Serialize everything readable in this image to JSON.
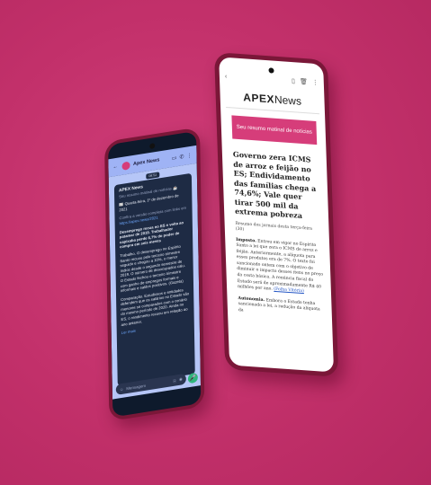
{
  "news_app": {
    "logo_brand": "APEX",
    "logo_word": "News",
    "banner": "Seu resumo matinal de notícias",
    "headline": "Governo zera ICMS de arroz e feijão no ES; Endividamento das famílias chega a 74,6%; Vale quer tirar 500 mil da extrema pobreza",
    "subtitle": "Resumo dos jornais desta terça-feira (30)",
    "para1_label": "Imposto.",
    "para1_text": "Entrou em vigor no Espírito Santo a lei que zera o ICMS de arroz e feijão. Anteriormente, a alíquota para esses produtos era de 7%. O texto foi sancionado ontem com o objetivo de diminuir o impacto desses itens no preço da cesta básica. A renúncia fiscal do Estado será de aproximadamente R$ 40 milhões por ano.",
    "para1_link": "(Folha Vitória)",
    "para2_label": "Autonomia.",
    "para2_text": "Embora o Estado tenha sancionado a lei, a redução da alíquota da"
  },
  "chat_app": {
    "contact": "Apex News",
    "time_chip": "08:52",
    "brand": "APEX News",
    "greeting": "Seu resumo matinal de notícias ☕",
    "date_line": "📰 Quarta-feira, 1º de dezembro de 2021",
    "link_intro": "Confira a versão completa com links em",
    "link": "https://apex.news/2021",
    "para1": "Desemprego recua no ES e volta ao patamar de 2019. Trabalhador capixaba perde 6,7% do poder de compra em seis meses",
    "para2": "Trabalho. O desemprego no Espírito Santo recuou pelo terceiro trimestre seguido e chegou a 10%, o menor índice desde o segundo semestre de 2019. O número de desocupados caiu. O Estado fechou o terceiro trimestre com ganho de empregos formais e informais e saldos positivos. (Gazeta)",
    "para3": "Comparação. Estudiosos e entidades defendem que os salários no Estado são menores se comparados com o cenário do mesmo período de 2020. Ainda no ES, o rendimento recuou em relação ao ano anterior.",
    "see_more": "Ler mais",
    "input_placeholder": "Mensagem"
  }
}
